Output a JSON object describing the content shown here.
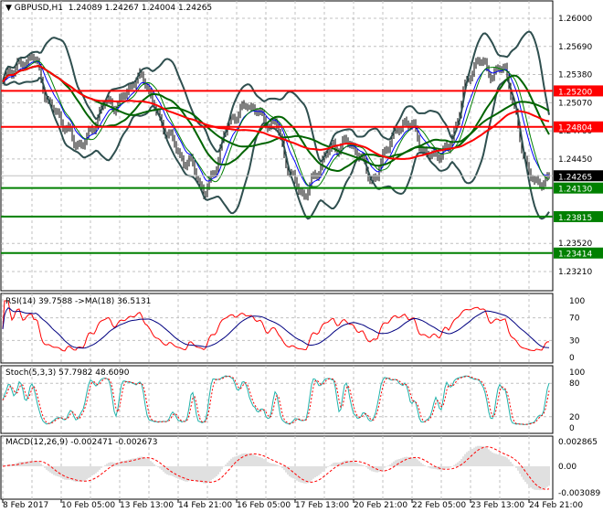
{
  "header": {
    "symbol": "GBPUSD,H1",
    "ohlc": "1.24089 1.24267 1.24004 1.24265"
  },
  "colors": {
    "red_level": "#ff0000",
    "green_level": "#008000",
    "bands": "#2f4f4f",
    "price_label": "#000000",
    "rsi": "#ff0000",
    "rsi_ma": "#000080",
    "stoch_main": "#20b2aa",
    "stoch_signal": "#ff0000",
    "macd_hist": "#c0c0c0",
    "macd_signal": "#ff0000"
  },
  "chart_data": [
    {
      "type": "line",
      "name": "GBPUSD,H1",
      "ylim": [
        1.2321,
        1.26
      ],
      "y_ticks": [
        "1.26000",
        "1.25690",
        "1.25380",
        "1.25070",
        "1.24760",
        "1.24450",
        "1.23520",
        "1.23210"
      ],
      "x_ticks": [
        "8 Feb 2017",
        "10 Feb 05:00",
        "13 Feb 13:00",
        "14 Feb 21:00",
        "16 Feb 05:00",
        "17 Feb 13:00",
        "20 Feb 21:00",
        "22 Feb 05:00",
        "23 Feb 13:00",
        "24 Feb 21:00"
      ],
      "close": [
        1.253,
        1.2545,
        1.2565,
        1.251,
        1.2495,
        1.2455,
        1.2475,
        1.25,
        1.251,
        1.2525,
        1.2535,
        1.248,
        1.246,
        1.244,
        1.2405,
        1.245,
        1.249,
        1.251,
        1.2485,
        1.249,
        1.242,
        1.241,
        1.243,
        1.2465,
        1.246,
        1.2445,
        1.242,
        1.247,
        1.249,
        1.246,
        1.245,
        1.245,
        1.252,
        1.255,
        1.2545,
        1.254,
        1.247,
        1.241,
        1.24265
      ],
      "last_price": {
        "value": 1.24265,
        "label": "1.24265"
      },
      "levels": [
        {
          "value": 1.252,
          "label": "1.25200",
          "color": "red"
        },
        {
          "value": 1.24804,
          "label": "1.24804",
          "color": "red"
        },
        {
          "value": 1.2413,
          "label": "1.24130",
          "color": "green"
        },
        {
          "value": 1.23815,
          "label": "1.23815",
          "color": "green"
        },
        {
          "value": 1.23414,
          "label": "1.23414",
          "color": "green"
        }
      ]
    },
    {
      "type": "line",
      "title": "RSI(14) 39.7588  ->MA(18) 36.5131",
      "ylim": [
        0,
        100
      ],
      "y_ticks": [
        "100",
        "70",
        "30",
        "0"
      ]
    },
    {
      "type": "line",
      "title": "Stoch(5,3,3) 57.7982 48.6090",
      "ylim": [
        0,
        100
      ],
      "y_ticks": [
        "100",
        "80",
        "20",
        "0"
      ]
    },
    {
      "type": "bar",
      "title": "MACD(12,26,9) -0.002471 -0.002673",
      "ylim": [
        -0.003089,
        0.002865
      ],
      "y_ticks": [
        "0.002865",
        "0.00",
        "-0.003089"
      ]
    }
  ]
}
